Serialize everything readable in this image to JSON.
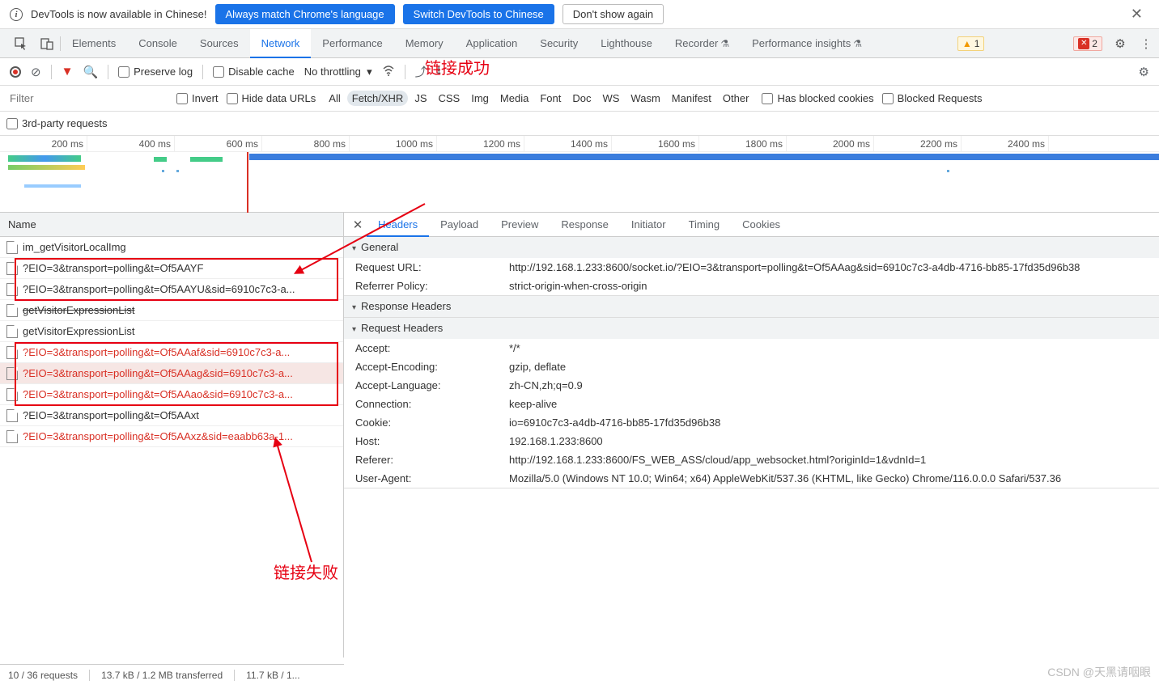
{
  "banner": {
    "text": "DevTools is now available in Chinese!",
    "btn1": "Always match Chrome's language",
    "btn2": "Switch DevTools to Chinese",
    "btn3": "Don't show again"
  },
  "mainTabs": [
    "Elements",
    "Console",
    "Sources",
    "Network",
    "Performance",
    "Memory",
    "Application",
    "Security",
    "Lighthouse",
    "Recorder",
    "Performance insights"
  ],
  "mainTabActive": "Network",
  "mainTabFlask": [
    "Recorder",
    "Performance insights"
  ],
  "warnCount": "1",
  "errCount": "2",
  "toolbar": {
    "preserve": "Preserve log",
    "disableCache": "Disable cache",
    "throttling": "No throttling"
  },
  "filterBar": {
    "placeholder": "Filter",
    "invert": "Invert",
    "hideData": "Hide data URLs",
    "types": [
      "All",
      "Fetch/XHR",
      "JS",
      "CSS",
      "Img",
      "Media",
      "Font",
      "Doc",
      "WS",
      "Wasm",
      "Manifest",
      "Other"
    ],
    "typeActive": "Fetch/XHR",
    "blocked1": "Has blocked cookies",
    "blocked2": "Blocked Requests",
    "thirdParty": "3rd-party requests"
  },
  "timelineTicks": [
    "200 ms",
    "400 ms",
    "600 ms",
    "800 ms",
    "1000 ms",
    "1200 ms",
    "1400 ms",
    "1600 ms",
    "1800 ms",
    "2000 ms",
    "2200 ms",
    "2400 ms"
  ],
  "leftHeader": "Name",
  "requests": [
    {
      "name": "im_getVisitorLocalImg",
      "red": false
    },
    {
      "name": "?EIO=3&transport=polling&t=Of5AAYF",
      "red": false
    },
    {
      "name": "?EIO=3&transport=polling&t=Of5AAYU&sid=6910c7c3-a...",
      "red": false
    },
    {
      "name": "getVisitorExpressionList",
      "red": false,
      "strike": true
    },
    {
      "name": "getVisitorExpressionList",
      "red": false
    },
    {
      "name": "?EIO=3&transport=polling&t=Of5AAaf&sid=6910c7c3-a...",
      "red": true
    },
    {
      "name": "?EIO=3&transport=polling&t=Of5AAag&sid=6910c7c3-a...",
      "red": true,
      "selected": true
    },
    {
      "name": "?EIO=3&transport=polling&t=Of5AAao&sid=6910c7c3-a...",
      "red": true
    },
    {
      "name": "?EIO=3&transport=polling&t=Of5AAxt",
      "red": false
    },
    {
      "name": "?EIO=3&transport=polling&t=Of5AAxz&sid=eaabb63a-1...",
      "red": true
    }
  ],
  "detailTabs": [
    "Headers",
    "Payload",
    "Preview",
    "Response",
    "Initiator",
    "Timing",
    "Cookies"
  ],
  "detailTabActive": "Headers",
  "sections": {
    "general": "General",
    "responseHeaders": "Response Headers",
    "requestHeaders": "Request Headers"
  },
  "general": [
    {
      "k": "Request URL:",
      "v": "http://192.168.1.233:8600/socket.io/?EIO=3&transport=polling&t=Of5AAag&sid=6910c7c3-a4db-4716-bb85-17fd35d96b38"
    },
    {
      "k": "Referrer Policy:",
      "v": "strict-origin-when-cross-origin"
    }
  ],
  "reqHeaders": [
    {
      "k": "Accept:",
      "v": "*/*"
    },
    {
      "k": "Accept-Encoding:",
      "v": "gzip, deflate"
    },
    {
      "k": "Accept-Language:",
      "v": "zh-CN,zh;q=0.9"
    },
    {
      "k": "Connection:",
      "v": "keep-alive"
    },
    {
      "k": "Cookie:",
      "v": "io=6910c7c3-a4db-4716-bb85-17fd35d96b38"
    },
    {
      "k": "Host:",
      "v": "192.168.1.233:8600"
    },
    {
      "k": "Referer:",
      "v": "http://192.168.1.233:8600/FS_WEB_ASS/cloud/app_websocket.html?originId=1&vdnId=1"
    },
    {
      "k": "User-Agent:",
      "v": "Mozilla/5.0 (Windows NT 10.0; Win64; x64) AppleWebKit/537.36 (KHTML, like Gecko) Chrome/116.0.0.0 Safari/537.36"
    }
  ],
  "status": {
    "s1": "10 / 36 requests",
    "s2": "13.7 kB / 1.2 MB transferred",
    "s3": "11.7 kB / 1..."
  },
  "annotations": {
    "success": "链接成功",
    "fail": "链接失败"
  },
  "watermark": "CSDN @天黑请咽眼"
}
